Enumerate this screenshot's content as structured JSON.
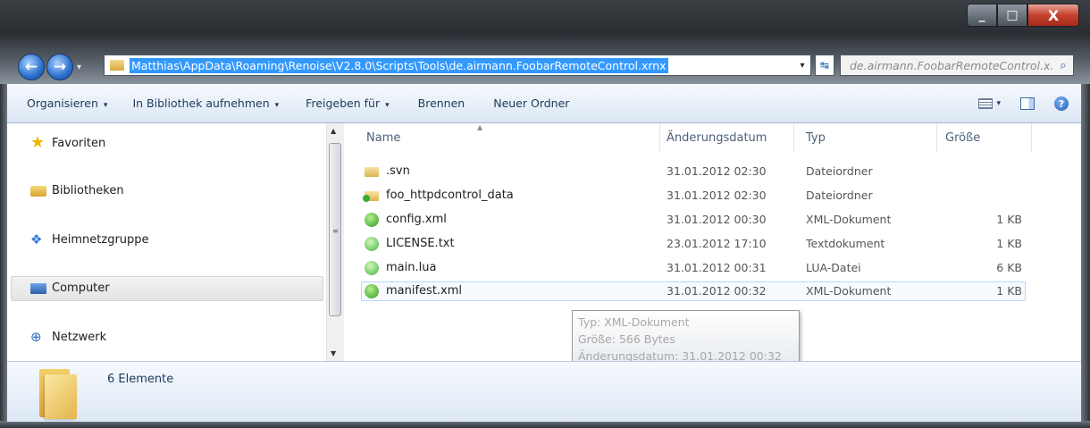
{
  "window": {
    "caption_min": "_",
    "caption_max": "□",
    "caption_close": "X"
  },
  "navigation": {
    "back_glyph": "←",
    "forward_glyph": "→",
    "recent_dropdown_glyph": "▾",
    "address_path": "Matthias\\AppData\\Roaming\\Renoise\\V2.8.0\\Scripts\\Tools\\de.airmann.FoobarRemoteControl.xrnx",
    "address_dropdown_glyph": "▾",
    "refresh_glyph": "↹",
    "search_placeholder": "de.airmann.FoobarRemoteControl.x...",
    "search_icon": "search-icon"
  },
  "toolbar": {
    "organize": "Organisieren",
    "add_to_library": "In Bibliothek aufnehmen",
    "share_with": "Freigeben für",
    "burn": "Brennen",
    "new_folder": "Neuer Ordner",
    "dropdown_glyph": "▾",
    "view_dropdown_glyph": "▾",
    "help_glyph": "?"
  },
  "nav_pane": {
    "items": [
      {
        "label": "Favoriten",
        "icon": "star-icon"
      },
      {
        "label": "Bibliotheken",
        "icon": "library-icon"
      },
      {
        "label": "Heimnetzgruppe",
        "icon": "homegroup-icon"
      },
      {
        "label": "Computer",
        "icon": "computer-icon"
      },
      {
        "label": "Netzwerk",
        "icon": "network-icon"
      }
    ],
    "selected": "Computer",
    "scroll_up_glyph": "▲",
    "scroll_down_glyph": "▼",
    "scroll_grip_glyph": "≡"
  },
  "file_list": {
    "columns": [
      "Name",
      "Änderungsdatum",
      "Typ",
      "Größe"
    ],
    "sort_glyph": "▲",
    "rows": [
      {
        "name": ".svn",
        "date": "31.01.2012 02:30",
        "type": "Dateiordner",
        "size": "",
        "icon": "folder-icon"
      },
      {
        "name": "foo_httpdcontrol_data",
        "date": "31.01.2012 02:30",
        "type": "Dateiordner",
        "size": "",
        "icon": "folder-svn-icon"
      },
      {
        "name": "config.xml",
        "date": "31.01.2012 00:30",
        "type": "XML-Dokument",
        "size": "1 KB",
        "icon": "xml-file-icon"
      },
      {
        "name": "LICENSE.txt",
        "date": "23.01.2012 17:10",
        "type": "Textdokument",
        "size": "1 KB",
        "icon": "text-file-icon"
      },
      {
        "name": "main.lua",
        "date": "31.01.2012 00:31",
        "type": "LUA-Datei",
        "size": "6 KB",
        "icon": "lua-file-icon"
      },
      {
        "name": "manifest.xml",
        "date": "31.01.2012 00:32",
        "type": "XML-Dokument",
        "size": "1 KB",
        "icon": "xml-file-icon"
      }
    ],
    "selected_row": "manifest.xml"
  },
  "tooltip": {
    "line1": "Typ: XML-Dokument",
    "line2": "Größe: 566 Bytes",
    "line3": "Änderungsdatum: 31.01.2012 00:32"
  },
  "details": {
    "item_count": "6 Elemente"
  }
}
